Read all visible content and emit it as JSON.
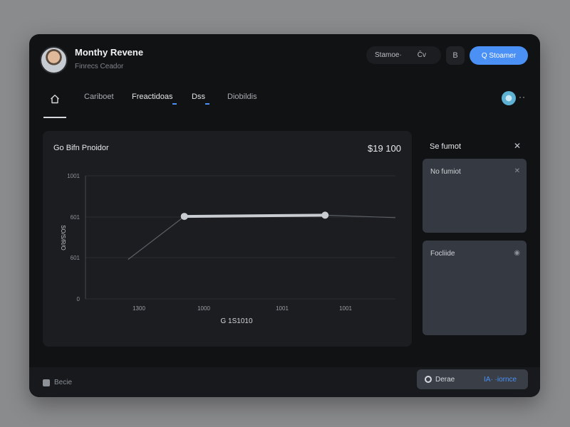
{
  "header": {
    "title": "Monthy Revene",
    "subtitle": "Finrecs Ceador",
    "pill_left": "Stamoe·",
    "pill_right": "C̄v",
    "square_icon": "B",
    "primary_label": "Q Stoamer"
  },
  "nav": {
    "tabs": [
      {
        "label": "Cariboet"
      },
      {
        "label": "Freactidoas",
        "active": true
      },
      {
        "label": "Dss"
      },
      {
        "label": "Diobildis"
      }
    ],
    "more": "··"
  },
  "chart_card": {
    "title": "Go Bifn Pnoidor",
    "total": "$19 100"
  },
  "chart_data": {
    "type": "line",
    "title": "Go Bifn Pnoidor",
    "xlabel": "G 1S1010",
    "ylabel": "SO/S/R/O",
    "y_ticks": [
      "1001",
      "601",
      "601",
      "0"
    ],
    "x_ticks": [
      "1300",
      "1000",
      "1001",
      "1001"
    ],
    "series": [
      {
        "points": [
          {
            "x": 0.05,
            "y": 0.32
          },
          {
            "x": 0.25,
            "y": 0.67
          },
          {
            "x": 0.75,
            "y": 0.68
          },
          {
            "x": 1.0,
            "y": 0.66
          }
        ],
        "highlighted": [
          1,
          2
        ]
      }
    ],
    "grid": true
  },
  "panel": {
    "header": "Se fumot",
    "cards": [
      {
        "label": "No fumiot",
        "icon": "x-icon"
      },
      {
        "label": "Focliide",
        "icon": "eye-icon"
      }
    ]
  },
  "footer": {
    "left_label": "Becie",
    "button_left": "Derae",
    "button_right": "IA· ·iornce"
  },
  "colors": {
    "accent": "#4a90f5",
    "background": "#111214",
    "card": "#1c1d20",
    "panel_card": "#353a42"
  }
}
